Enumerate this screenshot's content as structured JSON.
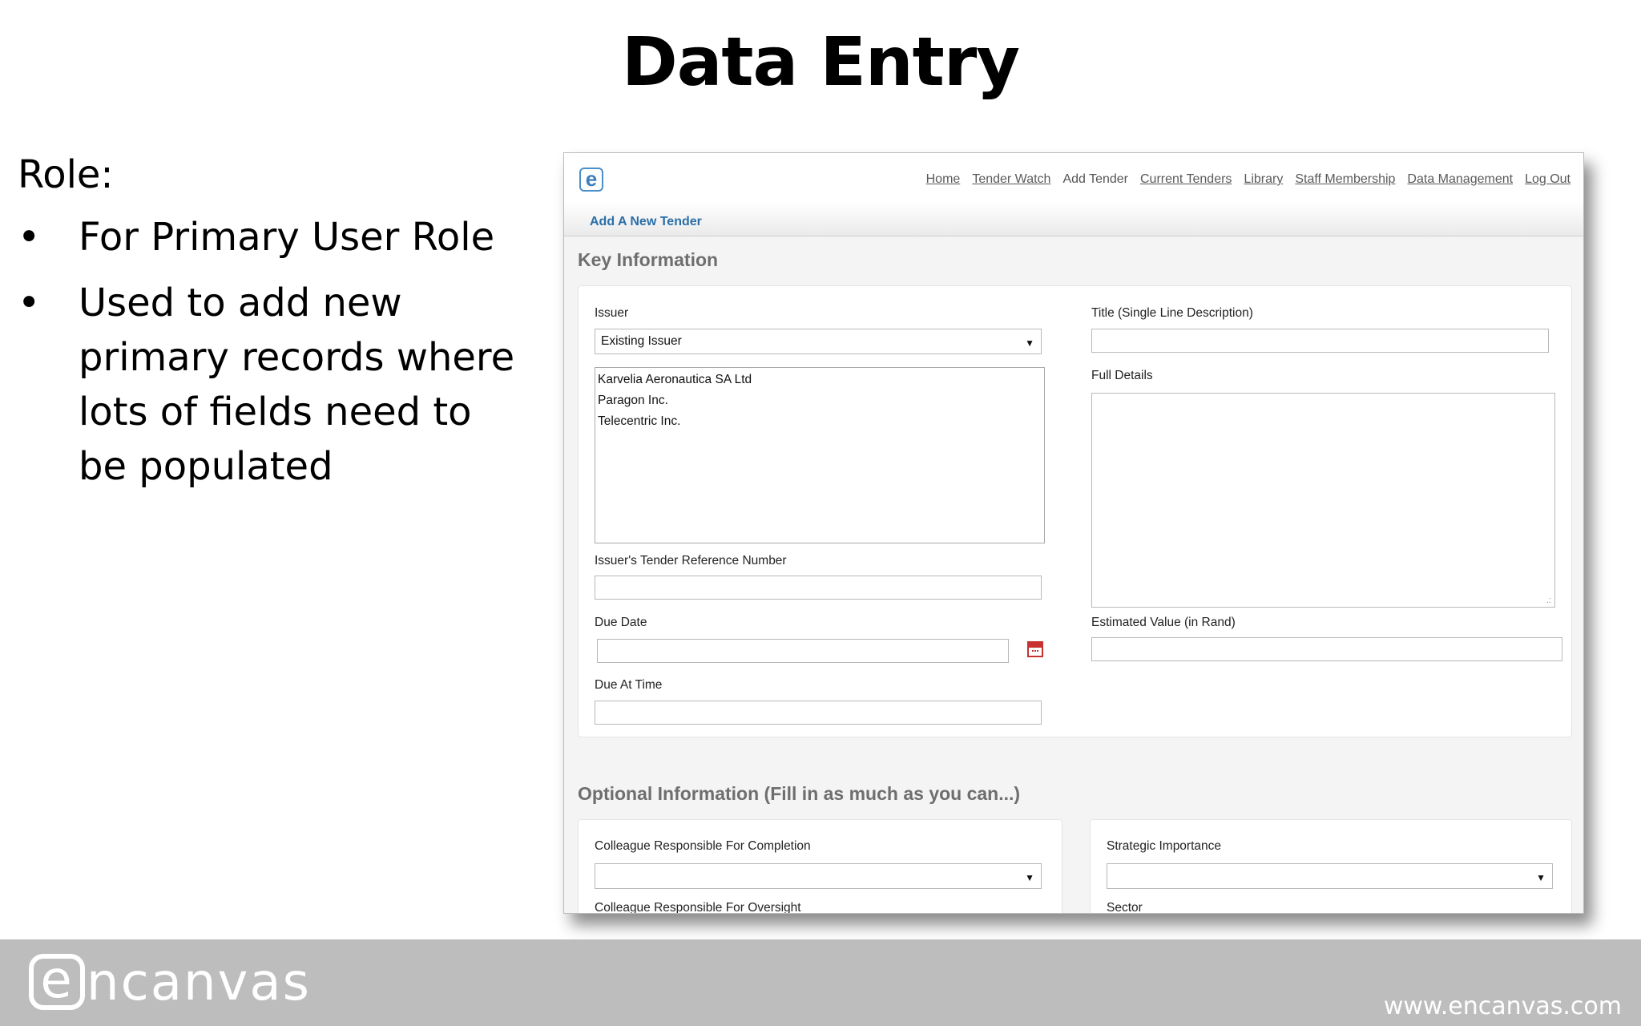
{
  "slide": {
    "title": "Data Entry",
    "role_label": "Role:",
    "bullets": [
      "For Primary User Role",
      "Used to add new primary records where lots of fields need to be populated"
    ]
  },
  "app": {
    "logo": "e",
    "nav": [
      "Home",
      "Tender Watch",
      "Add Tender",
      "Current Tenders",
      "Library",
      "Staff Membership",
      "Data Management",
      "Log Out"
    ],
    "subnav_tab": "Add A New Tender",
    "key_info": {
      "heading": "Key Information",
      "issuer_label": "Issuer",
      "issuer_select": "Existing Issuer",
      "issuer_options": [
        "Karvelia Aeronautica SA Ltd",
        "Paragon Inc.",
        "Telecentric Inc."
      ],
      "ref_label": "Issuer's Tender Reference Number",
      "ref_value": "",
      "due_date_label": "Due Date",
      "due_date_value": "",
      "due_time_label": "Due At Time",
      "due_time_value": "",
      "title_label": "Title (Single Line Description)",
      "title_value": "",
      "details_label": "Full Details",
      "details_value": "",
      "value_label": "Estimated Value (in Rand)",
      "value_value": ""
    },
    "optional_info": {
      "heading": "Optional Information (Fill in as much as you can...)",
      "completion_label": "Colleague Responsible For Completion",
      "oversight_label": "Colleague Responsible For Oversight",
      "strategic_label": "Strategic Importance",
      "sector_label": "Sector"
    }
  },
  "footer": {
    "logo": "ncanvas",
    "logo_e": "e",
    "url": "www.encanvas.com"
  }
}
